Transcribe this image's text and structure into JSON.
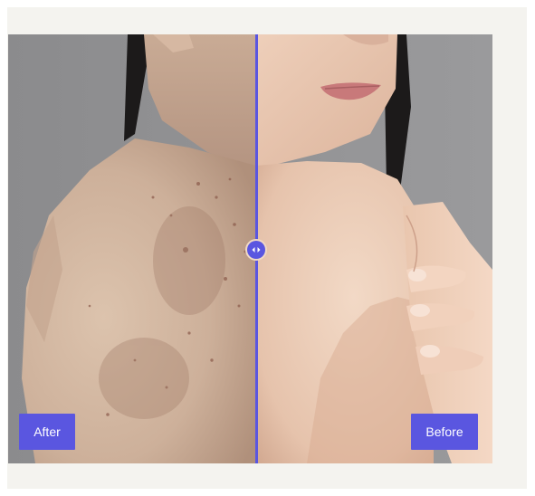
{
  "comparison": {
    "after_label": "After",
    "before_label": "Before",
    "divider_position_percent": 50.3,
    "accent_color": "#5a56e0",
    "background_color": "#f4f3ef",
    "handle_icon": "left-right-arrows-icon"
  }
}
